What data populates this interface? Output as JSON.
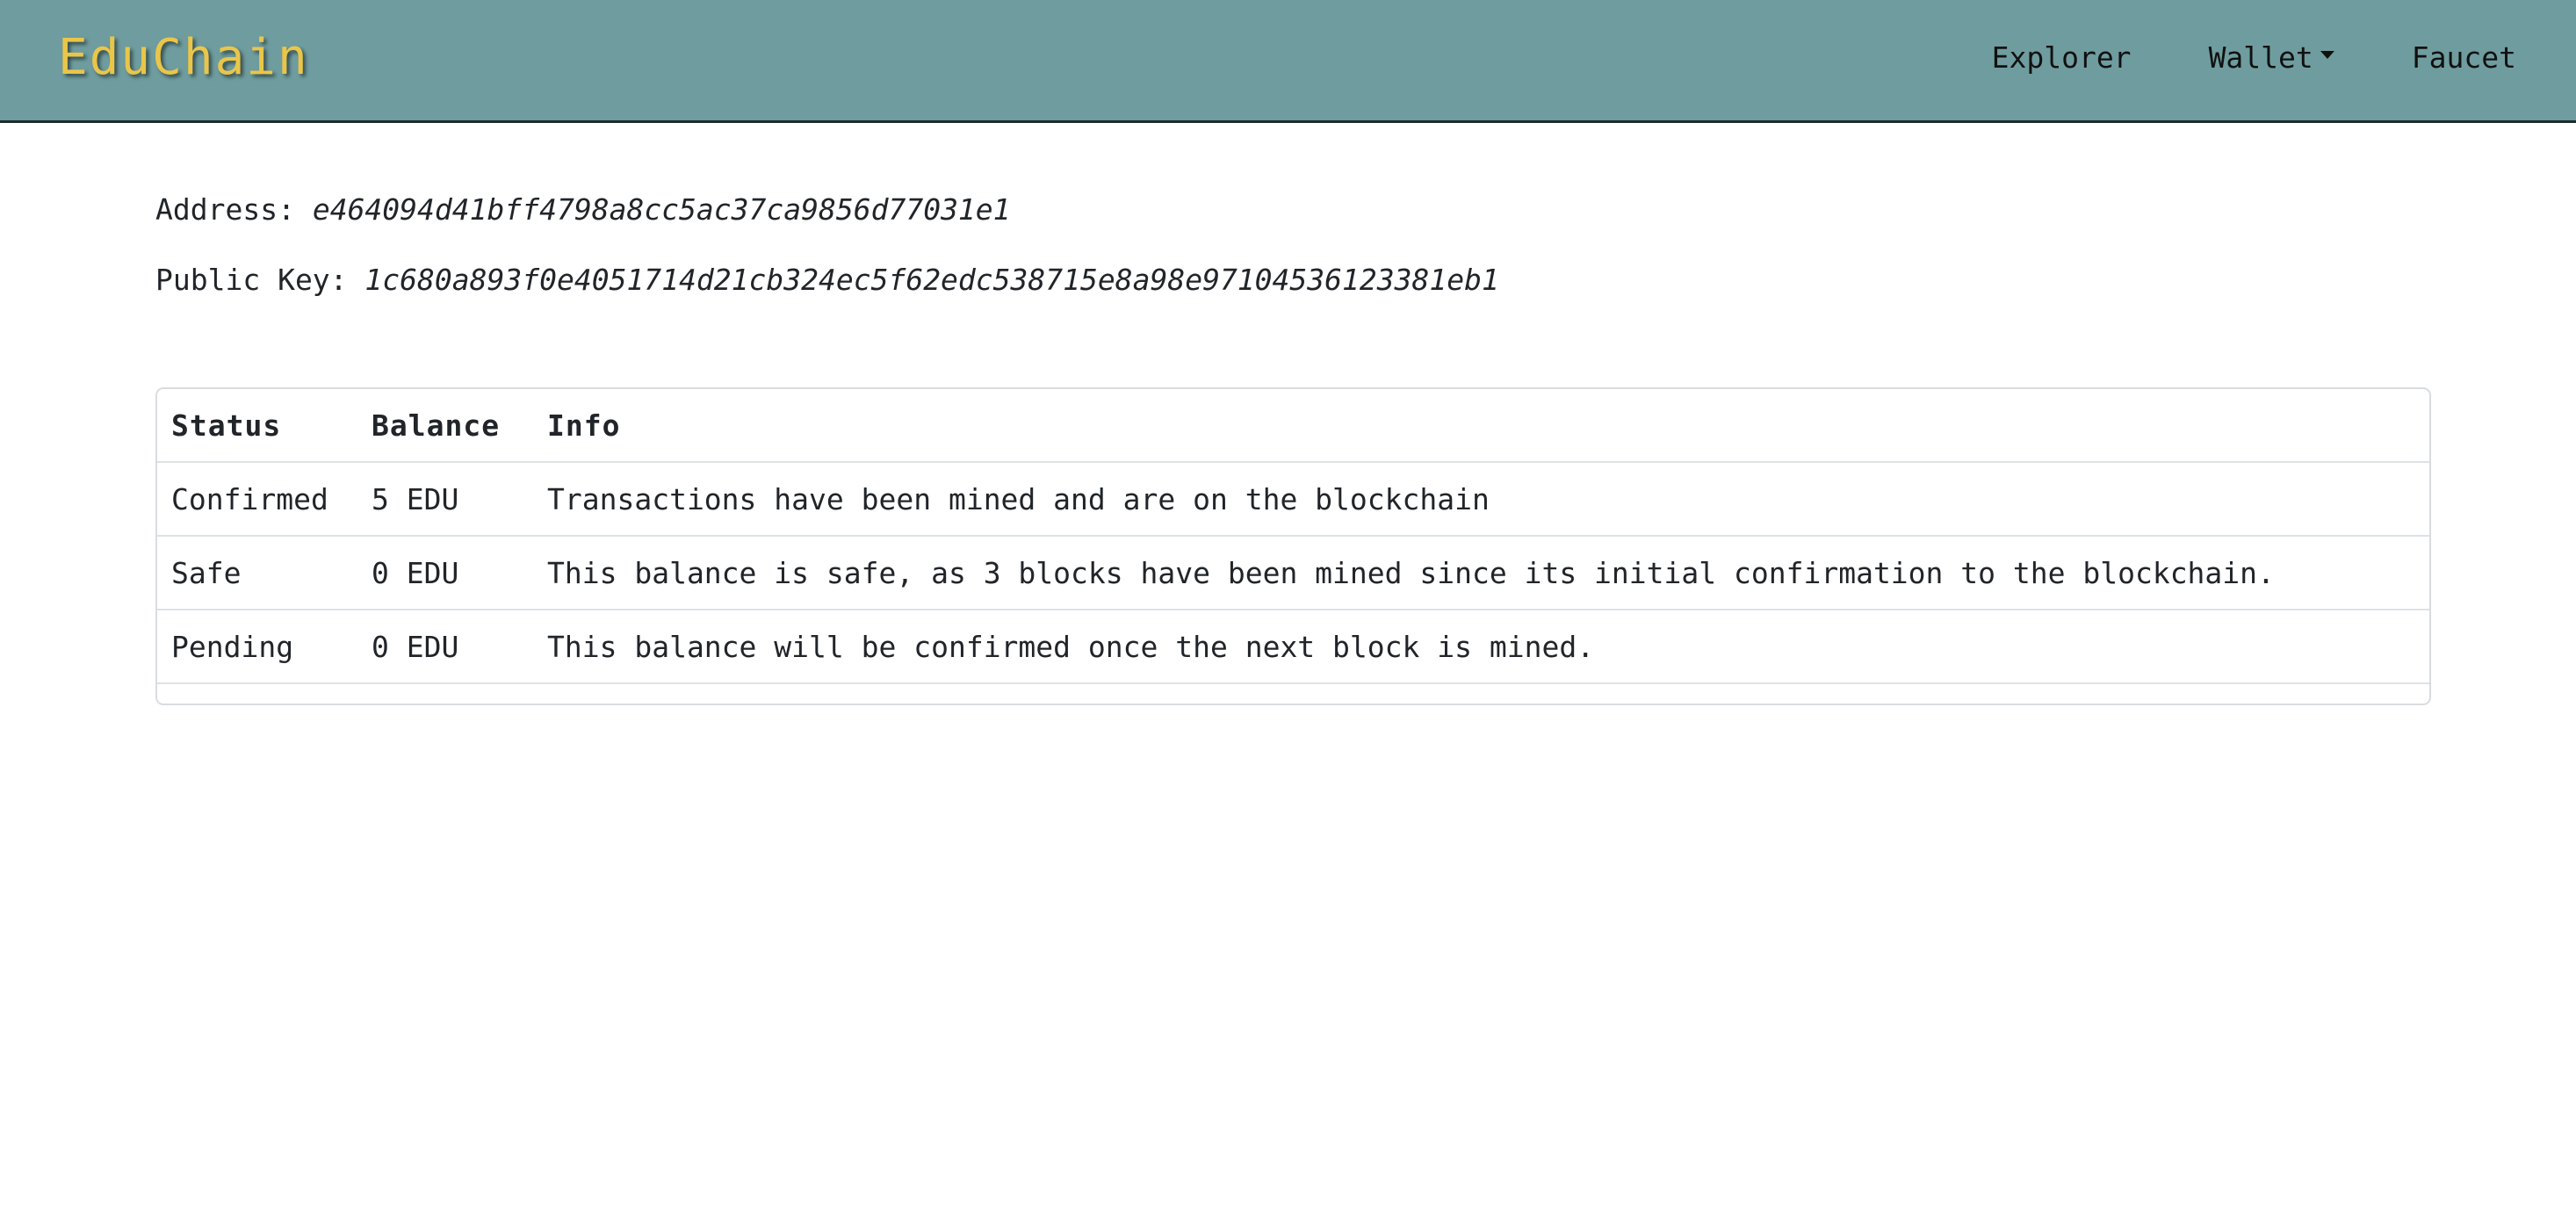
{
  "app": {
    "brand": "EduChain",
    "accent_color": "#6f9d9f",
    "brand_color": "#e9c64a"
  },
  "nav": {
    "items": [
      {
        "label": "Explorer"
      },
      {
        "label": "Wallet",
        "icon": "caret-down-icon"
      },
      {
        "label": "Faucet"
      }
    ]
  },
  "wallet": {
    "address_label": "Address:",
    "address_value": "e464094d41bff4798a8cc5ac37ca9856d77031e1",
    "pubkey_label": "Public Key:",
    "pubkey_value": "1c680a893f0e4051714d21cb324ec5f62edc538715e8a98e97104536123381eb1"
  },
  "balances": {
    "headers": [
      "Status",
      "Balance",
      "Info"
    ],
    "rows": [
      {
        "status": "Confirmed",
        "balance": "5 EDU",
        "info": "Transactions have been mined and are on the blockchain"
      },
      {
        "status": "Safe",
        "balance": "0 EDU",
        "info": "This balance is safe, as 3 blocks have been mined since its initial confirmation to the blockchain."
      },
      {
        "status": "Pending",
        "balance": "0 EDU",
        "info": "This balance will be confirmed once the next block is mined."
      }
    ]
  }
}
